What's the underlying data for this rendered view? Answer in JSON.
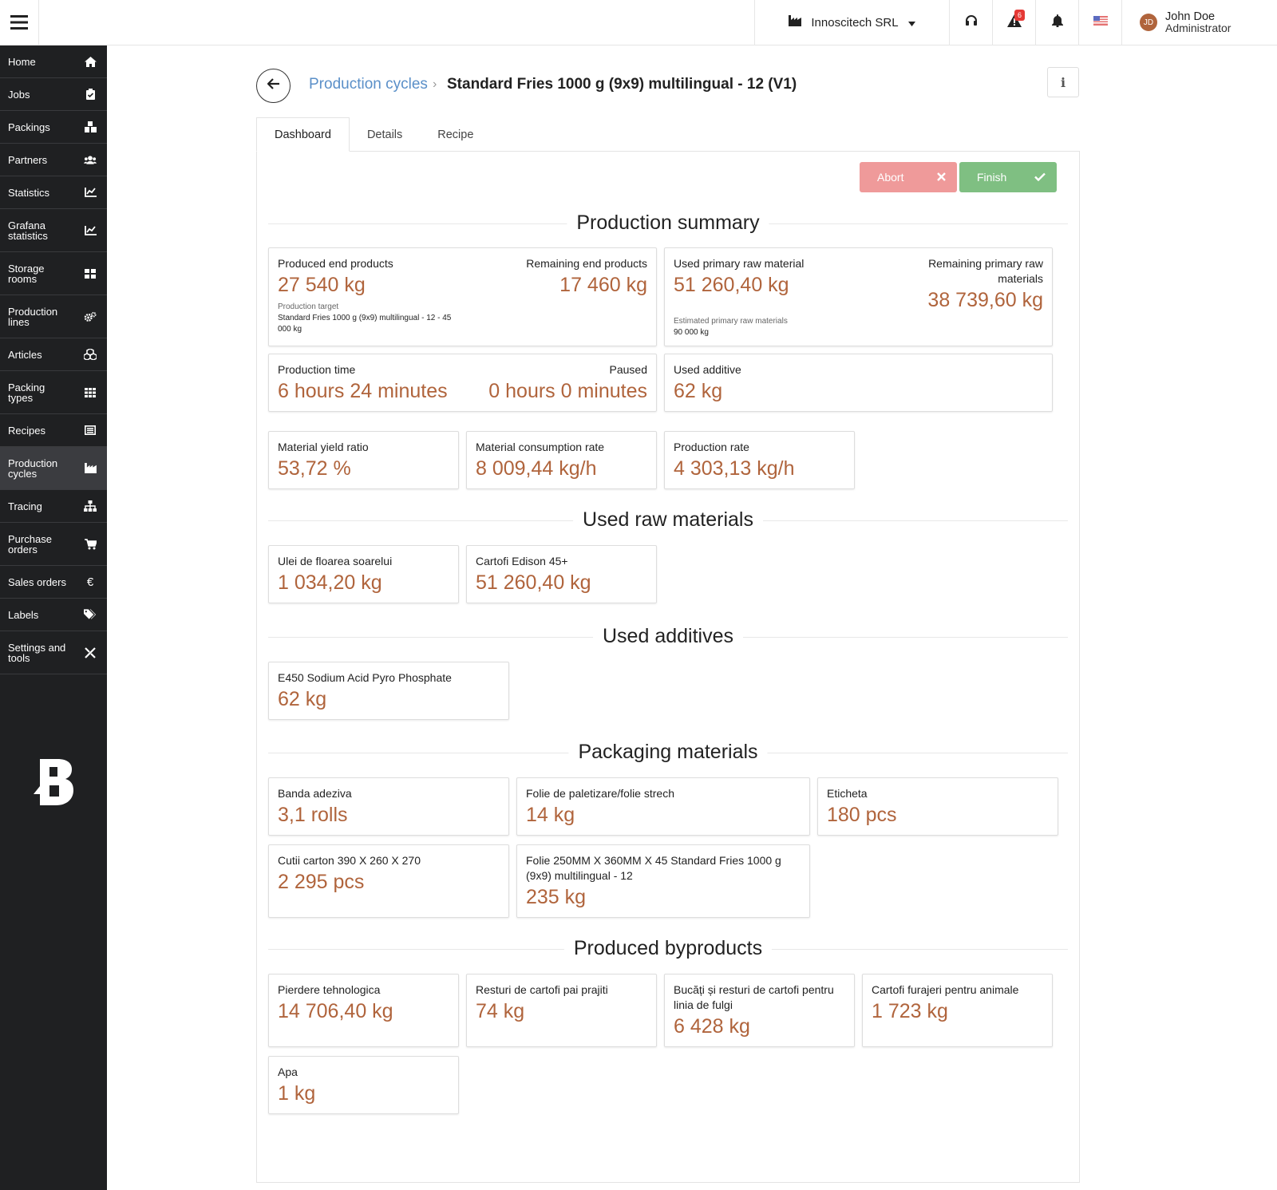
{
  "topbar": {
    "company": "Innoscitech SRL",
    "notification_count": "6",
    "user_initials": "JD",
    "user_name": "John Doe",
    "user_role": "Administrator"
  },
  "sidebar": {
    "items": [
      {
        "label": "Home",
        "icon": "home-icon"
      },
      {
        "label": "Jobs",
        "icon": "clipboard-check-icon"
      },
      {
        "label": "Packings",
        "icon": "boxes-icon"
      },
      {
        "label": "Partners",
        "icon": "users-icon"
      },
      {
        "label": "Statistics",
        "icon": "chart-line-icon"
      },
      {
        "label": "Grafana statistics",
        "icon": "chart-line-icon"
      },
      {
        "label": "Storage rooms",
        "icon": "grid-icon"
      },
      {
        "label": "Production lines",
        "icon": "cogs-icon"
      },
      {
        "label": "Articles",
        "icon": "cubes-icon"
      },
      {
        "label": "Packing types",
        "icon": "th-icon"
      },
      {
        "label": "Recipes",
        "icon": "list-alt-icon"
      },
      {
        "label": "Production cycles",
        "icon": "industry-icon"
      },
      {
        "label": "Tracing",
        "icon": "sitemap-icon"
      },
      {
        "label": "Purchase orders",
        "icon": "cart-icon"
      },
      {
        "label": "Sales orders",
        "icon": "euro-icon"
      },
      {
        "label": "Labels",
        "icon": "tags-icon"
      },
      {
        "label": "Settings and tools",
        "icon": "tools-icon"
      }
    ],
    "active": "Production cycles",
    "logo": "B"
  },
  "breadcrumb": {
    "parent": "Production cycles",
    "current": "Standard Fries 1000 g (9x9) multilingual - 12 (V1)"
  },
  "tabs": [
    "Dashboard",
    "Details",
    "Recipe"
  ],
  "actions": {
    "abort": "Abort",
    "finish": "Finish"
  },
  "summary": {
    "title": "Production summary",
    "produced_label": "Produced end products",
    "produced_value": "27 540 kg",
    "remaining_label": "Remaining end products",
    "remaining_value": "17 460 kg",
    "target_label": "Production target",
    "target_value": "Standard Fries 1000 g (9x9) multilingual - 12 - 45 000 kg",
    "used_primary_label": "Used primary raw material",
    "used_primary_value": "51 260,40 kg",
    "estimated_label": "Estimated primary raw materials",
    "estimated_value": "90 000 kg",
    "remaining_primary_label": "Remaining primary raw materials",
    "remaining_primary_value": "38 739,60 kg",
    "time_label": "Production time",
    "time_value": "6 hours 24 minutes",
    "paused_label": "Paused",
    "paused_value": "0 hours 0 minutes",
    "additive_label": "Used additive",
    "additive_value": "62 kg",
    "yield_label": "Material yield ratio",
    "yield_value": "53,72 %",
    "consumption_label": "Material consumption rate",
    "consumption_value": "8 009,44 kg/h",
    "rate_label": "Production rate",
    "rate_value": "4 303,13 kg/h"
  },
  "raw_materials": {
    "title": "Used raw materials",
    "items": [
      {
        "label": "Ulei de floarea soarelui",
        "value": "1 034,20 kg"
      },
      {
        "label": "Cartofi Edison 45+",
        "value": "51 260,40 kg"
      }
    ]
  },
  "additives": {
    "title": "Used additives",
    "items": [
      {
        "label": "E450 Sodium Acid Pyro Phosphate",
        "value": "62 kg"
      }
    ]
  },
  "packaging": {
    "title": "Packaging materials",
    "items": [
      {
        "label": "Banda adeziva",
        "value": "3,1 rolls"
      },
      {
        "label": "Folie de paletizare/folie strech",
        "value": "14 kg"
      },
      {
        "label": "Eticheta",
        "value": "180 pcs"
      },
      {
        "label": "Cutii carton 390 X 260 X 270",
        "value": "2 295 pcs"
      },
      {
        "label": "Folie 250MM X 360MM X 45 Standard Fries 1000 g (9x9) multilingual - 12",
        "value": "235 kg"
      }
    ]
  },
  "byproducts": {
    "title": "Produced byproducts",
    "items": [
      {
        "label": "Pierdere tehnologica",
        "value": "14 706,40 kg"
      },
      {
        "label": "Resturi de cartofi pai prajiti",
        "value": "74 kg"
      },
      {
        "label": "Bucăți și resturi de cartofi pentru linia de fulgi",
        "value": "6 428 kg"
      },
      {
        "label": "Cartofi furajeri pentru animale",
        "value": "1 723 kg"
      },
      {
        "label": "Apa",
        "value": "1 kg"
      }
    ]
  },
  "colors": {
    "accent_value": "#b0643c",
    "link": "#5a8fc8",
    "abort": "#ef9a9a",
    "finish": "#7fbf82",
    "sidebar_bg": "#1f2022"
  }
}
